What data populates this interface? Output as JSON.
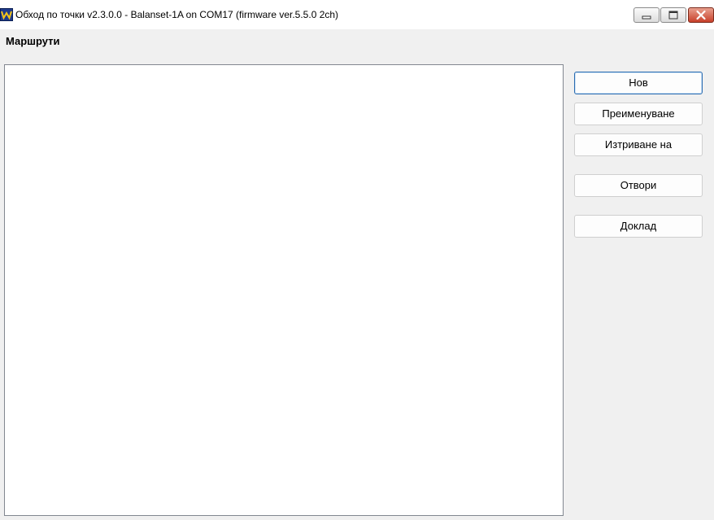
{
  "window": {
    "title": "Обход по точки v2.3.0.0 - Balanset-1A on COM17 (firmware ver.5.5.0 2ch)",
    "icon": "app-logo-icon",
    "controls": [
      "minimize-icon",
      "maximize-icon",
      "close-icon"
    ]
  },
  "routes": {
    "label": "Маршрути",
    "items": []
  },
  "actions": {
    "new_label": "Нов",
    "rename_label": "Преименуване",
    "delete_label": "Изтриване на",
    "open_label": "Отвори",
    "report_label": "Доклад"
  },
  "colors": {
    "background": "#f0f0f0",
    "list_background": "#ffffff",
    "default_button_border": "#2b6cb0",
    "close_button": "#c8402a"
  }
}
